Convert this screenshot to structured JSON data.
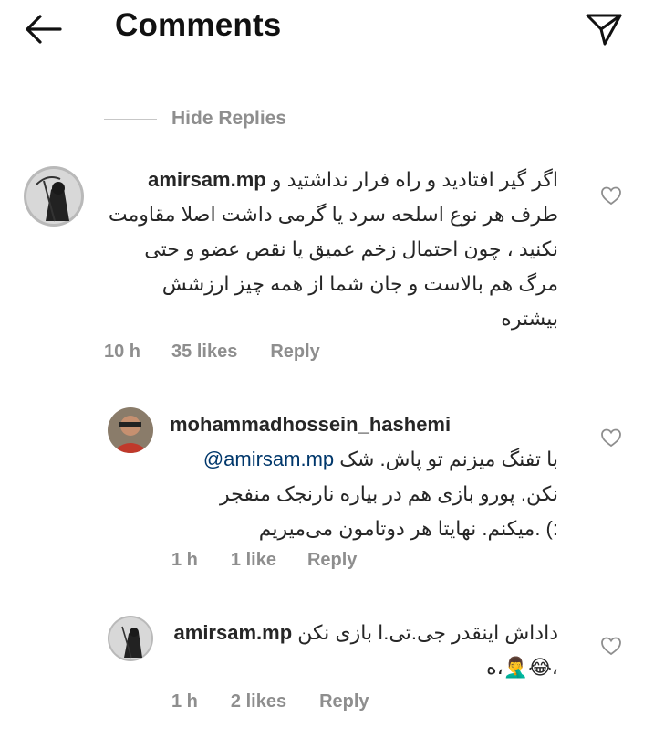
{
  "header": {
    "title": "Comments",
    "back_icon": "arrow-left-icon",
    "send_icon": "paper-plane-icon"
  },
  "hide_replies": {
    "label": "Hide Replies"
  },
  "comments": [
    {
      "username": "amirsam.mp",
      "text": "اگر گیر افتادید و راه فرار نداشتید و طرف هر نوع اسلحه سرد یا گرمی داشت اصلا مقاومت نکنید ، چون احتمال زخم عمیق یا نقص عضو و حتی مرگ هم بالاست و جان شما از همه چیز ارزشش بیشتره",
      "time": "10 h",
      "likes": "35 likes",
      "reply": "Reply"
    },
    {
      "username": "mohammadhossein_hashemi",
      "mention": "@amirsam.mp",
      "text": "با تفنگ میزنم تو پاش. شک نکن. پورو بازی هم در بیاره نارنجک منفجر میکنم. نهایتا هر دوتامون می‌میریم. (:",
      "time": "1 h",
      "likes": "1 like",
      "reply": "Reply"
    },
    {
      "username": "amirsam.mp",
      "text": "داداش اینقدر جی.تی.ا بازی نکن ،😂🤦‍♂️،ه",
      "time": "1 h",
      "likes": "2 likes",
      "reply": "Reply"
    }
  ],
  "colors": {
    "text": "#262626",
    "muted": "#8e8e8e",
    "mention": "#00376b",
    "divider": "#c7c7c7"
  }
}
